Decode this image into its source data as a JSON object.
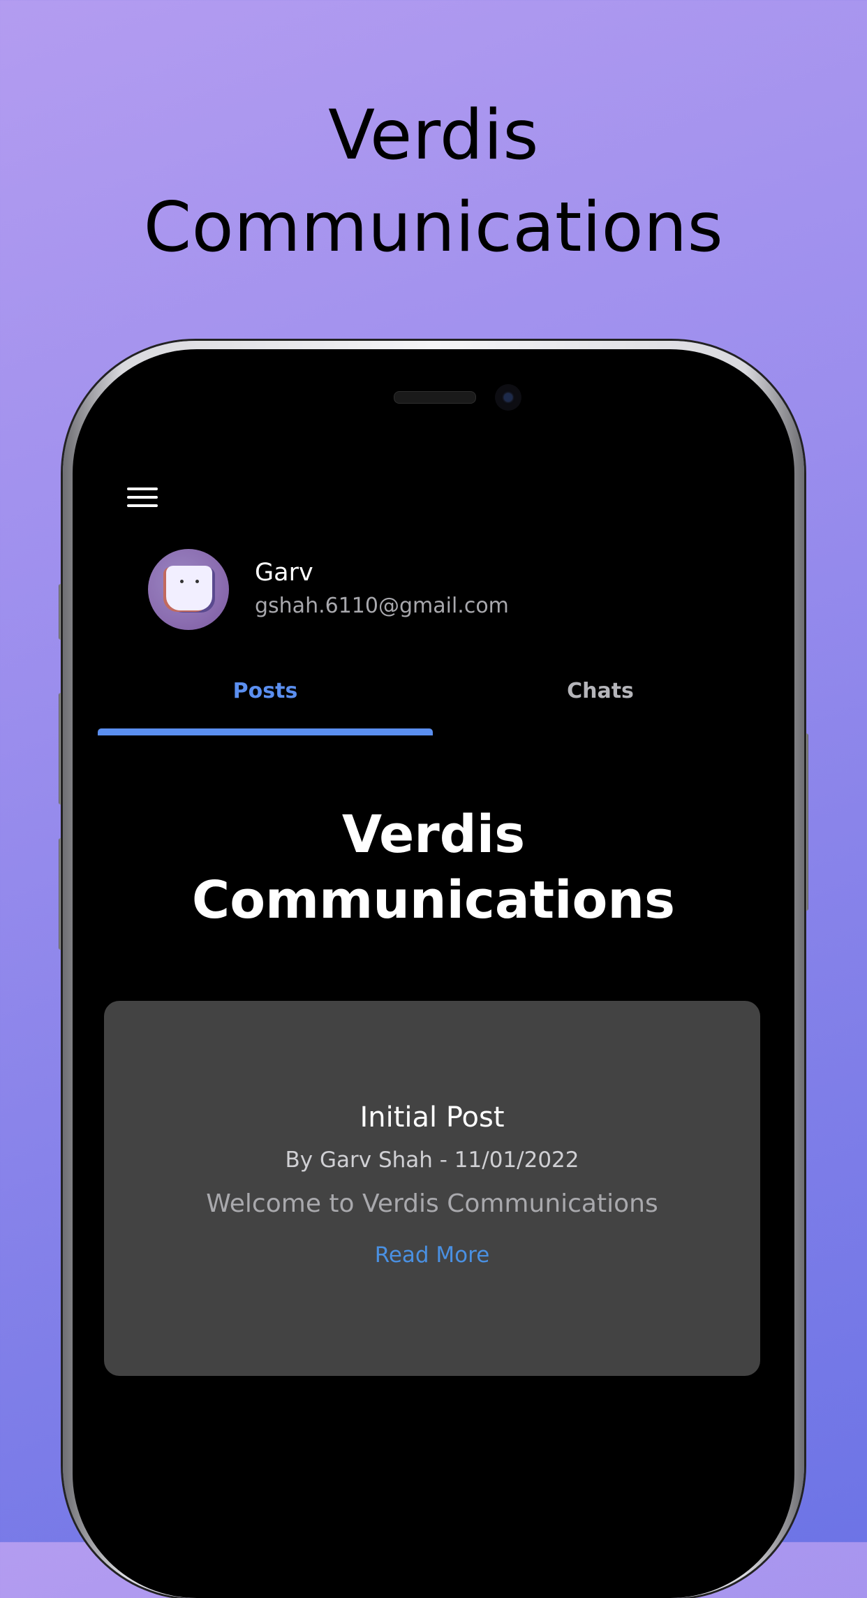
{
  "promo": {
    "title_line1": "Verdis",
    "title_line2": "Communications"
  },
  "header": {
    "menu_icon": "hamburger-menu-icon"
  },
  "profile": {
    "name": "Garv",
    "email": "gshah.6110@gmail.com"
  },
  "tabs": [
    {
      "label": "Posts",
      "active": true
    },
    {
      "label": "Chats",
      "active": false
    }
  ],
  "feed": {
    "title_line1": "Verdis",
    "title_line2": "Communications",
    "posts": [
      {
        "title": "Initial Post",
        "meta": "By Garv Shah - 11/01/2022",
        "body": "Welcome to Verdis Communications",
        "link_label": "Read More"
      }
    ]
  },
  "colors": {
    "accent": "#5b8ff0",
    "link": "#4a90e2",
    "card": "#434343",
    "background_top": "#b39cf0",
    "background_bottom": "#6d74e6"
  }
}
